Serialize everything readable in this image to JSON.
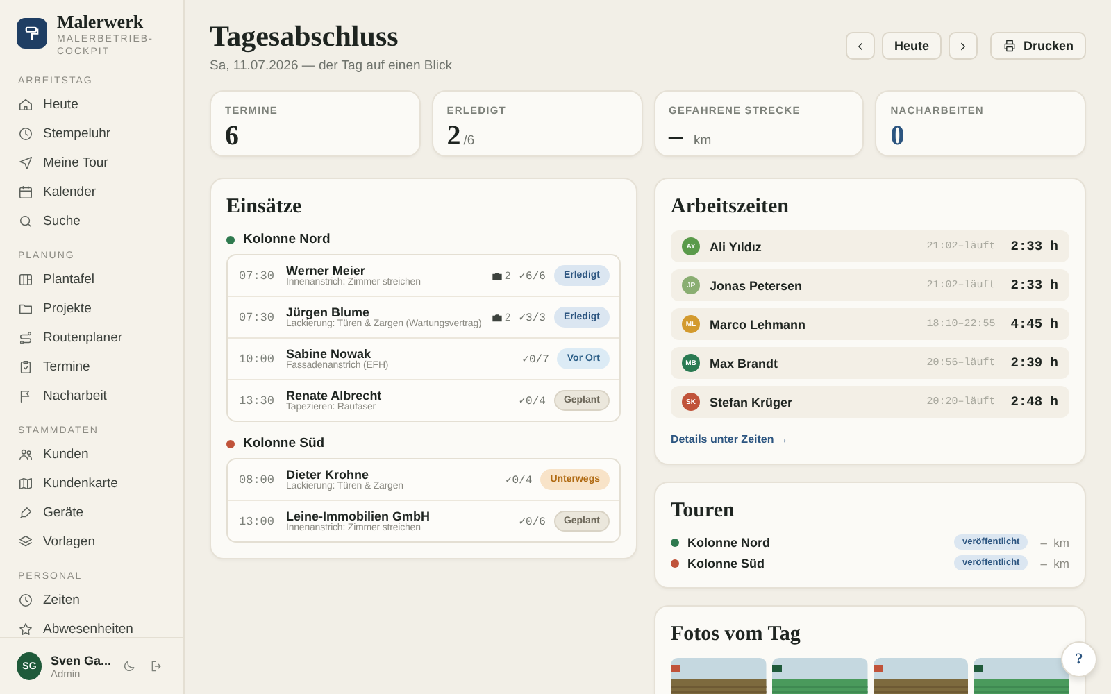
{
  "brand": {
    "name": "Malerwerk",
    "subtitle": "MALERBETRIEB-COCKPIT"
  },
  "sidebar": {
    "sections": [
      {
        "title": "ARBEITSTAG",
        "items": [
          {
            "label": "Heute"
          },
          {
            "label": "Stempeluhr"
          },
          {
            "label": "Meine Tour"
          },
          {
            "label": "Kalender"
          },
          {
            "label": "Suche"
          }
        ]
      },
      {
        "title": "PLANUNG",
        "items": [
          {
            "label": "Plantafel"
          },
          {
            "label": "Projekte"
          },
          {
            "label": "Routenplaner"
          },
          {
            "label": "Termine"
          },
          {
            "label": "Nacharbeit"
          }
        ]
      },
      {
        "title": "STAMMDATEN",
        "items": [
          {
            "label": "Kunden"
          },
          {
            "label": "Kundenkarte"
          },
          {
            "label": "Geräte"
          },
          {
            "label": "Vorlagen"
          }
        ]
      },
      {
        "title": "PERSONAL",
        "items": [
          {
            "label": "Zeiten"
          },
          {
            "label": "Abwesenheiten"
          }
        ]
      }
    ],
    "user": {
      "initials": "SG",
      "name": "Sven Ga...",
      "role": "Admin"
    }
  },
  "header": {
    "title": "Tagesabschluss",
    "subtitle": "Sa, 11.07.2026 — der Tag auf einen Blick",
    "today_button": "Heute",
    "print_button": "Drucken"
  },
  "stats": [
    {
      "label": "TERMINE",
      "value": "6",
      "kind": "plain"
    },
    {
      "label": "ERLEDIGT",
      "value": "2",
      "suffix": "/6",
      "kind": "plain"
    },
    {
      "label": "GEFAHRENE STRECKE",
      "value": "–",
      "suffix": "km",
      "kind": "plain"
    },
    {
      "label": "NACHARBEITEN",
      "value": "0",
      "kind": "accent"
    }
  ],
  "einsaetze": {
    "title": "Einsätze",
    "groups": [
      {
        "name": "Kolonne Nord",
        "color": "#2f7a4f",
        "rows": [
          {
            "time": "07:30",
            "name": "Werner Meier",
            "desc": "Innenanstrich: Zimmer streichen",
            "photos": "2",
            "checks": "✓6/6",
            "status": "Erledigt",
            "kind": "done"
          },
          {
            "time": "07:30",
            "name": "Jürgen Blume",
            "desc": "Lackierung: Türen & Zargen (Wartungsvertrag)",
            "photos": "2",
            "checks": "✓3/3",
            "status": "Erledigt",
            "kind": "done"
          },
          {
            "time": "10:00",
            "name": "Sabine Nowak",
            "desc": "Fassadenanstrich (EFH)",
            "checks": "✓0/7",
            "status": "Vor Ort",
            "kind": "onsite"
          },
          {
            "time": "13:30",
            "name": "Renate Albrecht",
            "desc": "Tapezieren: Raufaser",
            "checks": "✓0/4",
            "status": "Geplant",
            "kind": "planned"
          }
        ]
      },
      {
        "name": "Kolonne Süd",
        "color": "#c0533a",
        "rows": [
          {
            "time": "08:00",
            "name": "Dieter Krohne",
            "desc": "Lackierung: Türen & Zargen",
            "checks": "✓0/4",
            "status": "Unterwegs",
            "kind": "enroute"
          },
          {
            "time": "13:00",
            "name": "Leine-Immobilien GmbH",
            "desc": "Innenanstrich: Zimmer streichen",
            "checks": "✓0/6",
            "status": "Geplant",
            "kind": "planned"
          }
        ]
      }
    ]
  },
  "arbeitszeiten": {
    "title": "Arbeitszeiten",
    "rows": [
      {
        "initials": "AY",
        "color": "#5a9a4a",
        "name": "Ali Yıldız",
        "range": "21:02–läuft",
        "duration": "2:33 h"
      },
      {
        "initials": "JP",
        "color": "#8aae72",
        "name": "Jonas Petersen",
        "range": "21:02–läuft",
        "duration": "2:33 h"
      },
      {
        "initials": "ML",
        "color": "#d39a2e",
        "name": "Marco Lehmann",
        "range": "18:10–22:55",
        "duration": "4:45 h"
      },
      {
        "initials": "MB",
        "color": "#2a7a52",
        "name": "Max Brandt",
        "range": "20:56–läuft",
        "duration": "2:39 h"
      },
      {
        "initials": "SK",
        "color": "#c0533a",
        "name": "Stefan Krüger",
        "range": "20:20–läuft",
        "duration": "2:48 h"
      }
    ],
    "link": "Details unter Zeiten →"
  },
  "touren": {
    "title": "Touren",
    "rows": [
      {
        "name": "Kolonne Nord",
        "color": "#2f7a4f",
        "status": "veröffentlicht",
        "distance": "–  km"
      },
      {
        "name": "Kolonne Süd",
        "color": "#c0533a",
        "status": "veröffentlicht",
        "distance": "–  km"
      }
    ]
  },
  "fotos": {
    "title": "Fotos vom Tag"
  },
  "help_button": "?"
}
